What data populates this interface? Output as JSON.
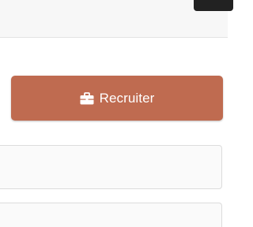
{
  "recruiter_button": {
    "label": "Recruiter",
    "icon": "briefcase-icon",
    "color": "#bf6b50"
  },
  "fields": [
    {
      "value": ""
    },
    {
      "value": ""
    }
  ]
}
